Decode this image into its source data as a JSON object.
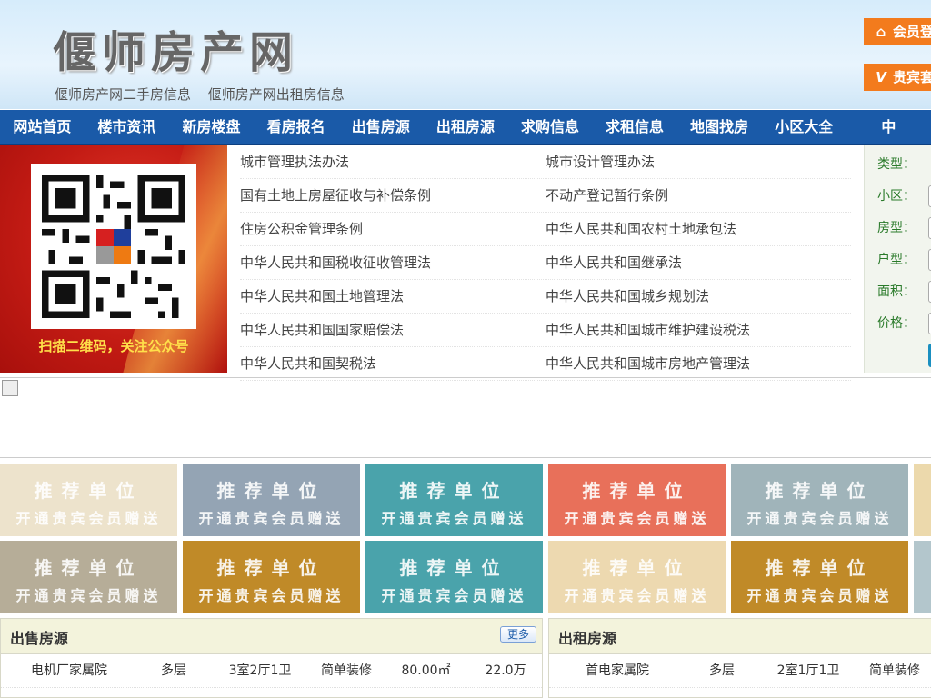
{
  "header": {
    "logo": "偃师房产网",
    "sublinks": [
      "偃师房产网二手房信息",
      "偃师房产网出租房信息"
    ],
    "member_login": "会员登",
    "vip_label": "贵宾套"
  },
  "nav": [
    "网站首页",
    "楼市资讯",
    "新房楼盘",
    "看房报名",
    "出售房源",
    "出租房源",
    "求购信息",
    "求租信息",
    "地图找房",
    "小区大全",
    "中"
  ],
  "qr": {
    "caption": "扫描二维码，关注公众号"
  },
  "laws": [
    [
      "城市管理执法办法",
      "城市设计管理办法"
    ],
    [
      "国有土地上房屋征收与补偿条例",
      "不动产登记暂行条例"
    ],
    [
      "住房公积金管理条例",
      "中华人民共和国农村土地承包法"
    ],
    [
      "中华人民共和国税收征收管理法",
      "中华人民共和国继承法"
    ],
    [
      "中华人民共和国土地管理法",
      "中华人民共和国城乡规划法"
    ],
    [
      "中华人民共和国国家赔偿法",
      "中华人民共和国城市维护建设税法"
    ],
    [
      "中华人民共和国契税法",
      "中华人民共和国城市房地产管理法"
    ]
  ],
  "search": {
    "labels": [
      "类型：",
      "小区：",
      "房型：",
      "户型：",
      "面积：",
      "价格："
    ]
  },
  "tiles": {
    "line1": "推荐单位",
    "line2": "开通贵宾会员赠送",
    "colors_row1": [
      "#ede3cc",
      "#94a4b4",
      "#4aa3ab",
      "#e8705a",
      "#a0b4ba",
      "#ecd9ac"
    ],
    "colors_row2": [
      "#b6ad98",
      "#c08a28",
      "#4aa3ab",
      "#edd9b0",
      "#c08a28",
      "#b3c6cc"
    ]
  },
  "sale": {
    "title": "出售房源",
    "more": "更多",
    "rows": [
      [
        "电机厂家属院",
        "多层",
        "3室2厅1卫",
        "简单装修",
        "80.00㎡",
        "22.0万"
      ]
    ]
  },
  "rent": {
    "title": "出租房源",
    "rows": [
      [
        "首电家属院",
        "多层",
        "2室1厅1卫",
        "简单装修"
      ]
    ]
  }
}
